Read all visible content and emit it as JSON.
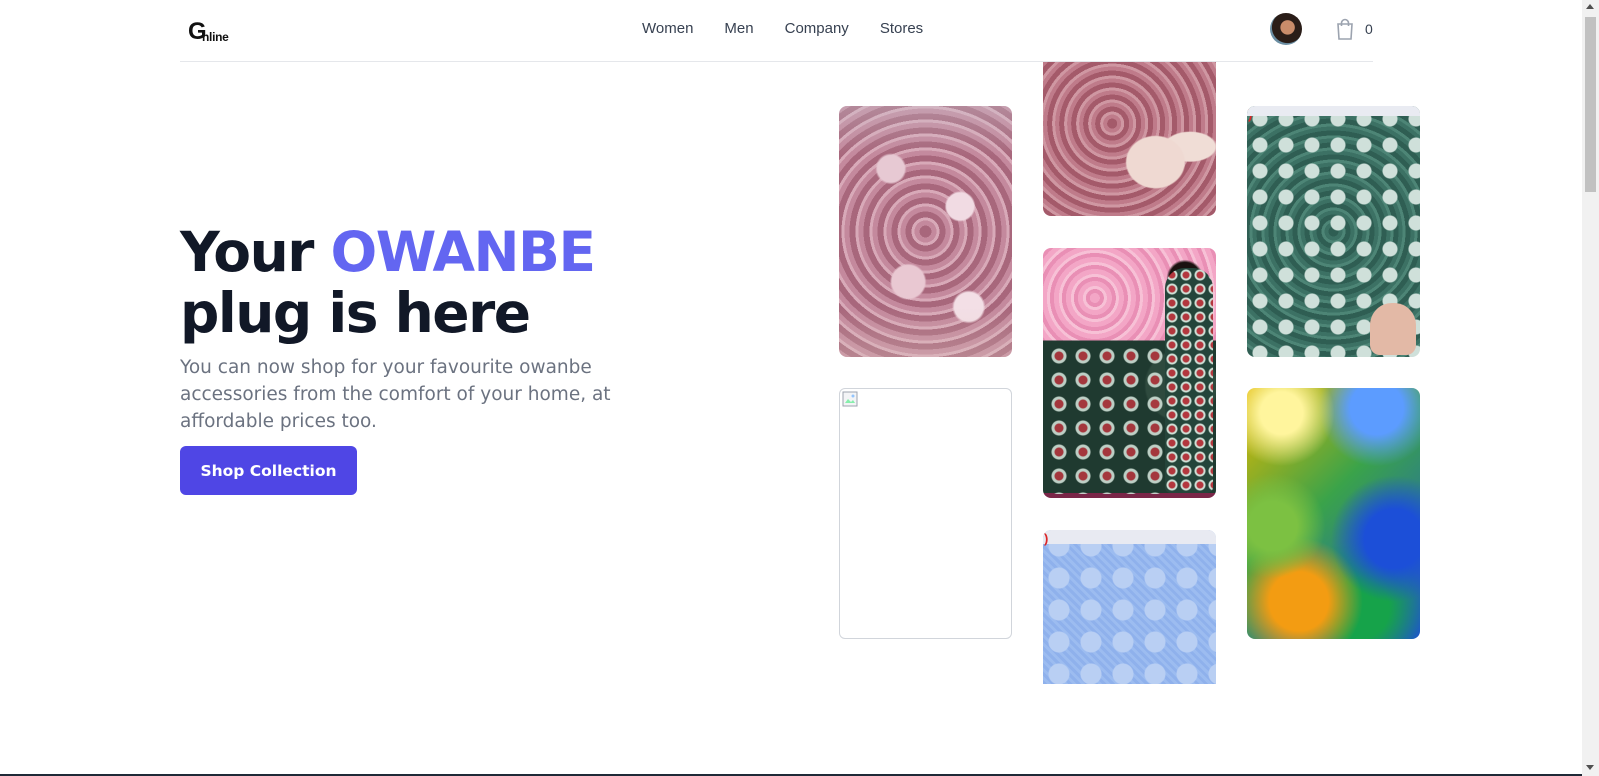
{
  "header": {
    "logo_initial": "G",
    "logo_rest": "nline",
    "nav": [
      "Women",
      "Men",
      "Company",
      "Stores"
    ],
    "cart_count": "0"
  },
  "hero": {
    "title_part1": "Your ",
    "title_accent": "OWANBE",
    "title_line2": "plug is here",
    "description": "You can now shop for your favourite owanbe accessories from the comfort of your home, at affordable prices too.",
    "cta_label": "Shop Collection"
  },
  "tiles": {
    "stray_mark": ")"
  },
  "colors": {
    "accent": "#6366f1",
    "button": "#4f46e5",
    "heading": "#111827",
    "muted_text": "#6b7280"
  },
  "icons": [
    "avatar",
    "shopping-bag-icon",
    "broken-image-icon"
  ]
}
